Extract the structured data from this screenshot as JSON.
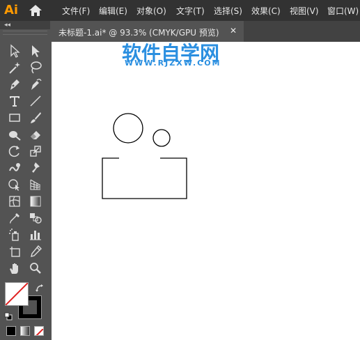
{
  "app": {
    "logo": "Ai"
  },
  "menu": {
    "items": [
      "文件(F)",
      "编辑(E)",
      "对象(O)",
      "文字(T)",
      "选择(S)",
      "效果(C)",
      "视图(V)",
      "窗口(W)"
    ]
  },
  "toolbar": {
    "collapse": "◂◂"
  },
  "document": {
    "tab_title": "未标题-1.ai* @ 93.3% (CMYK/GPU 预览)",
    "close": "✕"
  },
  "watermark": {
    "title": "软件自学网",
    "url": "WWW.RJZXW.COM"
  },
  "colors": {
    "fill": "#ffffff",
    "stroke": "#000000",
    "watermark": "#2b8fe0"
  },
  "icons": [
    "home-icon",
    "selection-tool-icon",
    "direct-selection-tool-icon",
    "magic-wand-icon",
    "lasso-icon",
    "pen-tool-icon",
    "curvature-tool-icon",
    "type-tool-icon",
    "line-segment-tool-icon",
    "rectangle-tool-icon",
    "paintbrush-tool-icon",
    "blob-brush-icon",
    "eraser-tool-icon",
    "rotate-tool-icon",
    "scale-tool-icon",
    "warp-tool-icon",
    "puppet-warp-icon",
    "shape-builder-icon",
    "perspective-grid-icon",
    "mesh-tool-icon",
    "gradient-tool-icon",
    "eyedropper-icon",
    "blend-tool-icon",
    "symbol-sprayer-icon",
    "column-graph-icon",
    "artboard-tool-icon",
    "slice-tool-icon",
    "hand-tool-icon",
    "zoom-tool-icon",
    "swap-icon",
    "default-colors-icon"
  ]
}
